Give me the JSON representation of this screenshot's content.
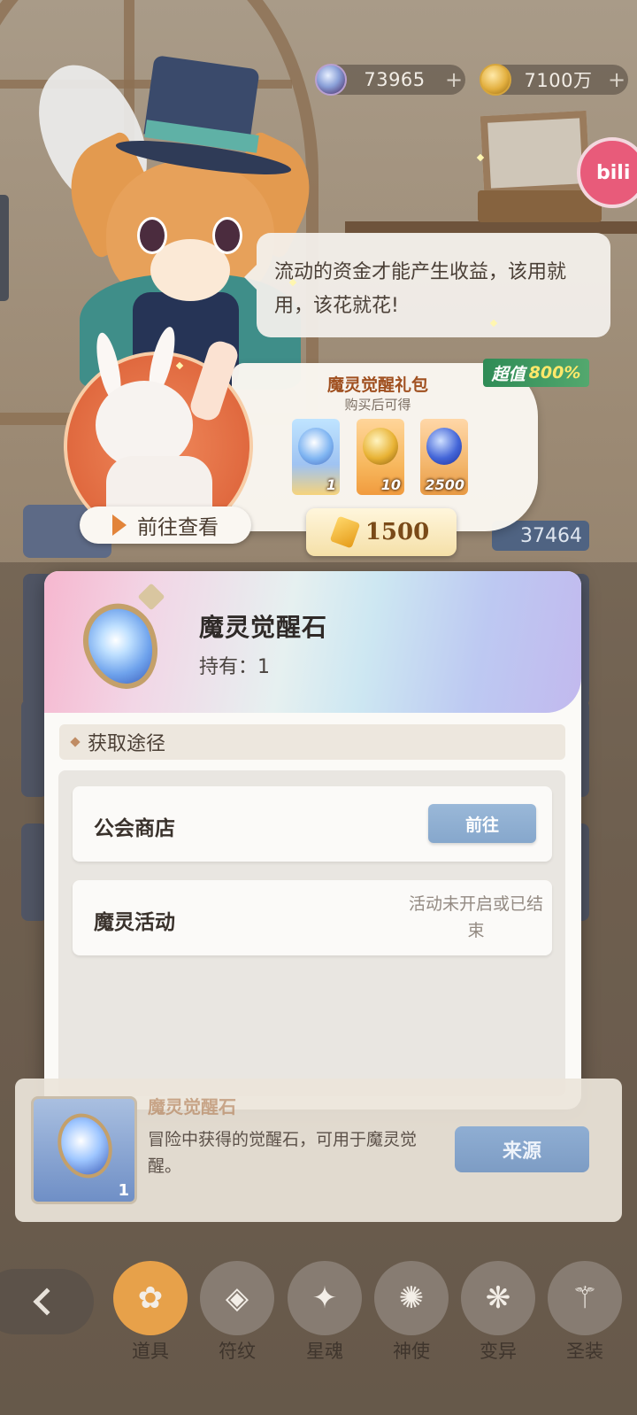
{
  "currencies": {
    "gems": "73965",
    "coins": "7100万",
    "plus": "+"
  },
  "badge": {
    "bili": "bili"
  },
  "speech": "流动的资金才能产生收益，该用就用，该花就花!",
  "gift_pack": {
    "title": "魔灵觉醒礼包",
    "subtitle": "购买后可得",
    "value_badge_prefix": "超值",
    "value_badge_amount": "800%",
    "items": [
      {
        "icon": "awakening-stone-icon",
        "count": "1"
      },
      {
        "icon": "golden-orb-icon",
        "count": "10"
      },
      {
        "icon": "blue-berry-icon",
        "count": "2500"
      }
    ],
    "price": "1500",
    "go_view_label": "前往查看"
  },
  "underlying_value": "37464",
  "dialog": {
    "item_name": "魔灵觉醒石",
    "owned_label": "持有：1",
    "section_title": "获取途径",
    "sources": [
      {
        "name": "公会商店",
        "action": "前往"
      },
      {
        "name": "魔灵活动",
        "status": "活动未开启或已结束"
      }
    ]
  },
  "description": {
    "title": "魔灵觉醒石",
    "text": "冒险中获得的觉醒石，可用于魔灵觉醒。",
    "qty": "1",
    "source_button": "来源"
  },
  "nav": {
    "tabs": [
      {
        "label": "道具",
        "icon": "bag-icon",
        "glyph": "✿",
        "active": true
      },
      {
        "label": "符纹",
        "icon": "rune-icon",
        "glyph": "◈"
      },
      {
        "label": "星魂",
        "icon": "star-card-icon",
        "glyph": "✦"
      },
      {
        "label": "神使",
        "icon": "angel-icon",
        "glyph": "✺"
      },
      {
        "label": "变异",
        "icon": "mutation-icon",
        "glyph": "❋"
      },
      {
        "label": "圣装",
        "icon": "holy-gear-icon",
        "glyph": "⚚"
      }
    ]
  }
}
